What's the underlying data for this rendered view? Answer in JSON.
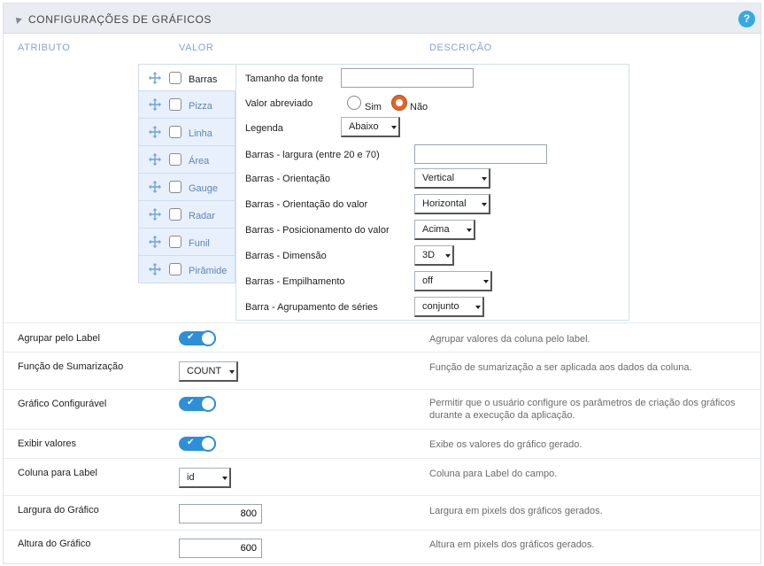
{
  "header": {
    "title": "CONFIGURAÇÕES DE GRÁFICOS",
    "help": "?"
  },
  "columns": {
    "attribute": "ATRIBUTO",
    "value": "VALOR",
    "description": "DESCRIÇÃO"
  },
  "chart_types": [
    {
      "label": "Barras",
      "checked": false,
      "active": true
    },
    {
      "label": "Pizza",
      "checked": false
    },
    {
      "label": "Linha",
      "checked": false
    },
    {
      "label": "Área",
      "checked": false
    },
    {
      "label": "Gauge",
      "checked": false
    },
    {
      "label": "Radar",
      "checked": false
    },
    {
      "label": "Funil",
      "checked": false
    },
    {
      "label": "Pirâmide",
      "checked": false
    }
  ],
  "settings": {
    "font_size": {
      "label": "Tamanho da fonte",
      "value": ""
    },
    "abbreviated": {
      "label": "Valor abreviado",
      "yes": "Sim",
      "no": "Não",
      "selected": "Não"
    },
    "legend": {
      "label": "Legenda",
      "value": "Abaixo"
    },
    "bar_width": {
      "label": "Barras - largura (entre 20 e 70)",
      "value": ""
    },
    "orientation": {
      "label": "Barras - Orientação",
      "value": "Vertical"
    },
    "value_orientation": {
      "label": "Barras - Orientação do valor",
      "value": "Horizontal"
    },
    "value_position": {
      "label": "Barras - Posicionamento do valor",
      "value": "Acima"
    },
    "dimension": {
      "label": "Barras - Dimensão",
      "value": "3D"
    },
    "stacking": {
      "label": "Barras - Empilhamento",
      "value": "off"
    },
    "grouping": {
      "label": "Barra - Agrupamento de séries",
      "value": "conjunto"
    }
  },
  "attributes": {
    "group_label": {
      "name": "Agrupar pelo Label",
      "on": true,
      "desc": "Agrupar valores da coluna pelo label."
    },
    "summarize": {
      "name": "Função de Sumarização",
      "value": "COUNT",
      "desc": "Função de sumarização a ser aplicada aos dados da coluna."
    },
    "configurable": {
      "name": "Gráfico Configurável",
      "on": true,
      "desc": "Permitir que o usuário configure os parâmetros de criação dos gráficos durante a execução da aplicação."
    },
    "show_values": {
      "name": "Exibir valores",
      "on": true,
      "desc": "Exibe os valores do gráfico gerado."
    },
    "label_column": {
      "name": "Coluna para Label",
      "value": "id",
      "desc": "Coluna para Label do campo."
    },
    "chart_width": {
      "name": "Largura do Gráfico",
      "value": "800",
      "desc": "Largura em pixels dos gráficos gerados."
    },
    "chart_height": {
      "name": "Altura do Gráfico",
      "value": "600",
      "desc": "Altura em pixels dos gráficos gerados."
    }
  },
  "toggle_check": "✔",
  "colors": {
    "accent": "#2d8fd8",
    "radio_selected": "#e0652a",
    "help": "#36a9e1",
    "header_bg": "#e9ecf1"
  }
}
